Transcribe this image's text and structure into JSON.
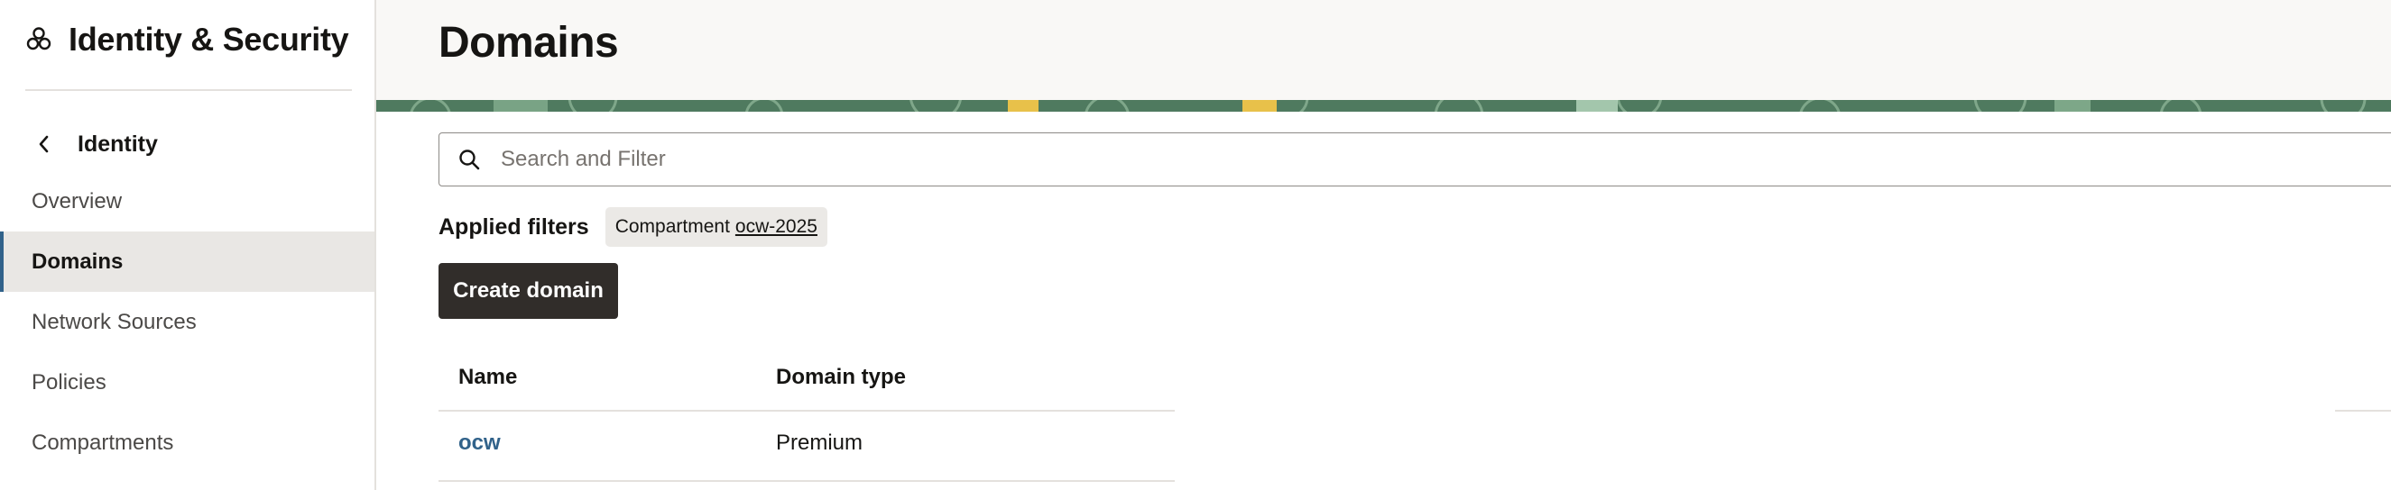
{
  "sidebar": {
    "brand_icon": "cubes-icon",
    "brand_title": "Identity & Security",
    "back": {
      "icon": "chevron-left-icon",
      "label": "Identity"
    },
    "items": [
      {
        "label": "Overview",
        "active": false
      },
      {
        "label": "Domains",
        "active": true
      },
      {
        "label": "Network Sources",
        "active": false
      },
      {
        "label": "Policies",
        "active": false
      },
      {
        "label": "Compartments",
        "active": false
      }
    ]
  },
  "header": {
    "title": "Domains"
  },
  "search": {
    "icon": "search-icon",
    "placeholder": "Search and Filter",
    "value": ""
  },
  "filters": {
    "label": "Applied filters",
    "chips": [
      {
        "key": "Compartment",
        "value": "ocw-2025"
      }
    ]
  },
  "toolbar": {
    "create_label": "Create domain"
  },
  "table": {
    "columns": [
      "Name",
      "Domain type"
    ],
    "rows": [
      {
        "name": "ocw",
        "domain_type": "Premium"
      }
    ]
  },
  "colors": {
    "accent": "#31628a",
    "primary_button": "#312d2a",
    "active_nav_bg": "#e9e7e4",
    "banner_green": "#4f7a5f"
  }
}
